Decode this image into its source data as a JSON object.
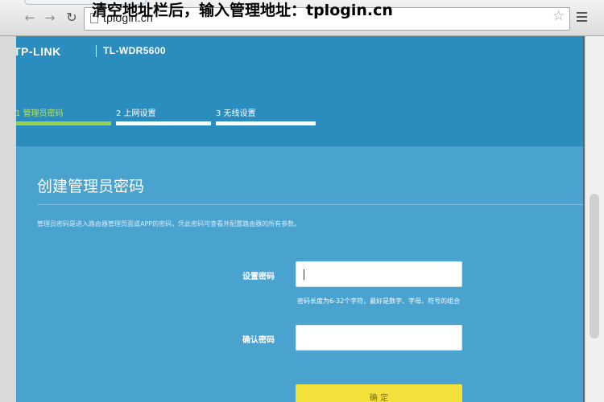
{
  "browser": {
    "url": "tplogin.cn",
    "annotation": "清空地址栏后，输入管理地址：tplogin.cn",
    "icons": {
      "back": "back-arrow-icon",
      "forward": "forward-arrow-icon",
      "reload": "reload-icon",
      "page": "page-icon",
      "star": "star-icon",
      "menu": "menu-icon"
    }
  },
  "router": {
    "brand": "TP-LINK",
    "model": "TL-WDR5600",
    "steps": [
      {
        "label": "1 管理员密码",
        "active": true
      },
      {
        "label": "2 上网设置",
        "active": false
      },
      {
        "label": "3 无线设置",
        "active": false
      }
    ],
    "title": "创建管理员密码",
    "description": "管理员密码是进入路由器管理页面或APP的密码，凭此密码可查看并配置路由器的所有参数。",
    "password_label": "设置密码",
    "password_value": "",
    "password_hint": "密码长度为6-32个字符，最好是数字、字母、符号的组合",
    "confirm_label": "确认密码",
    "confirm_value": "",
    "submit_label": "确 定"
  },
  "colors": {
    "header": "#2a8dbd",
    "body": "#4aa2cf",
    "active_step": "#9bd24a",
    "button": "#f4e03a"
  }
}
